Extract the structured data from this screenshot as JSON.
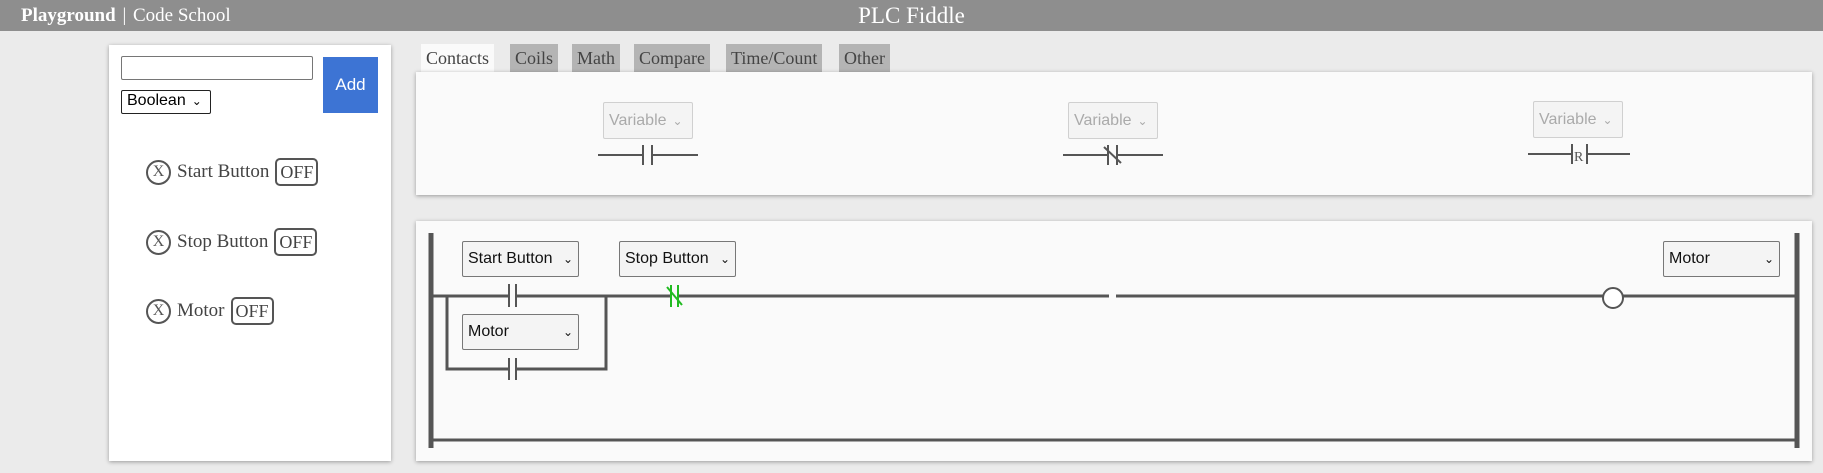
{
  "header": {
    "nav_playground": "Playground",
    "nav_separator": "|",
    "nav_codeschool": "Code School",
    "title": "PLC Fiddle"
  },
  "variables_panel": {
    "name_input_value": "",
    "type_select_value": "Boolean",
    "add_label": "Add",
    "items": [
      {
        "name": "Start Button",
        "state": "OFF",
        "delete_glyph": "X"
      },
      {
        "name": "Stop Button",
        "state": "OFF",
        "delete_glyph": "X"
      },
      {
        "name": "Motor",
        "state": "OFF",
        "delete_glyph": "X"
      }
    ]
  },
  "tabs": [
    {
      "label": "Contacts",
      "active": true
    },
    {
      "label": "Coils",
      "active": false
    },
    {
      "label": "Math",
      "active": false
    },
    {
      "label": "Compare",
      "active": false
    },
    {
      "label": "Time/Count",
      "active": false
    },
    {
      "label": "Other",
      "active": false
    }
  ],
  "palette": {
    "elements": [
      {
        "type": "normally-open-contact",
        "variable_label": "Variable"
      },
      {
        "type": "normally-closed-contact",
        "variable_label": "Variable"
      },
      {
        "type": "rising-edge-contact",
        "variable_label": "Variable",
        "symbol_text": "R"
      }
    ]
  },
  "ladder": {
    "rung": {
      "contact_start": "Start Button",
      "contact_stop": "Stop Button",
      "branch_contact": "Motor",
      "coil": "Motor"
    },
    "colors": {
      "line": "#555555",
      "energized": "#22bb22"
    }
  }
}
